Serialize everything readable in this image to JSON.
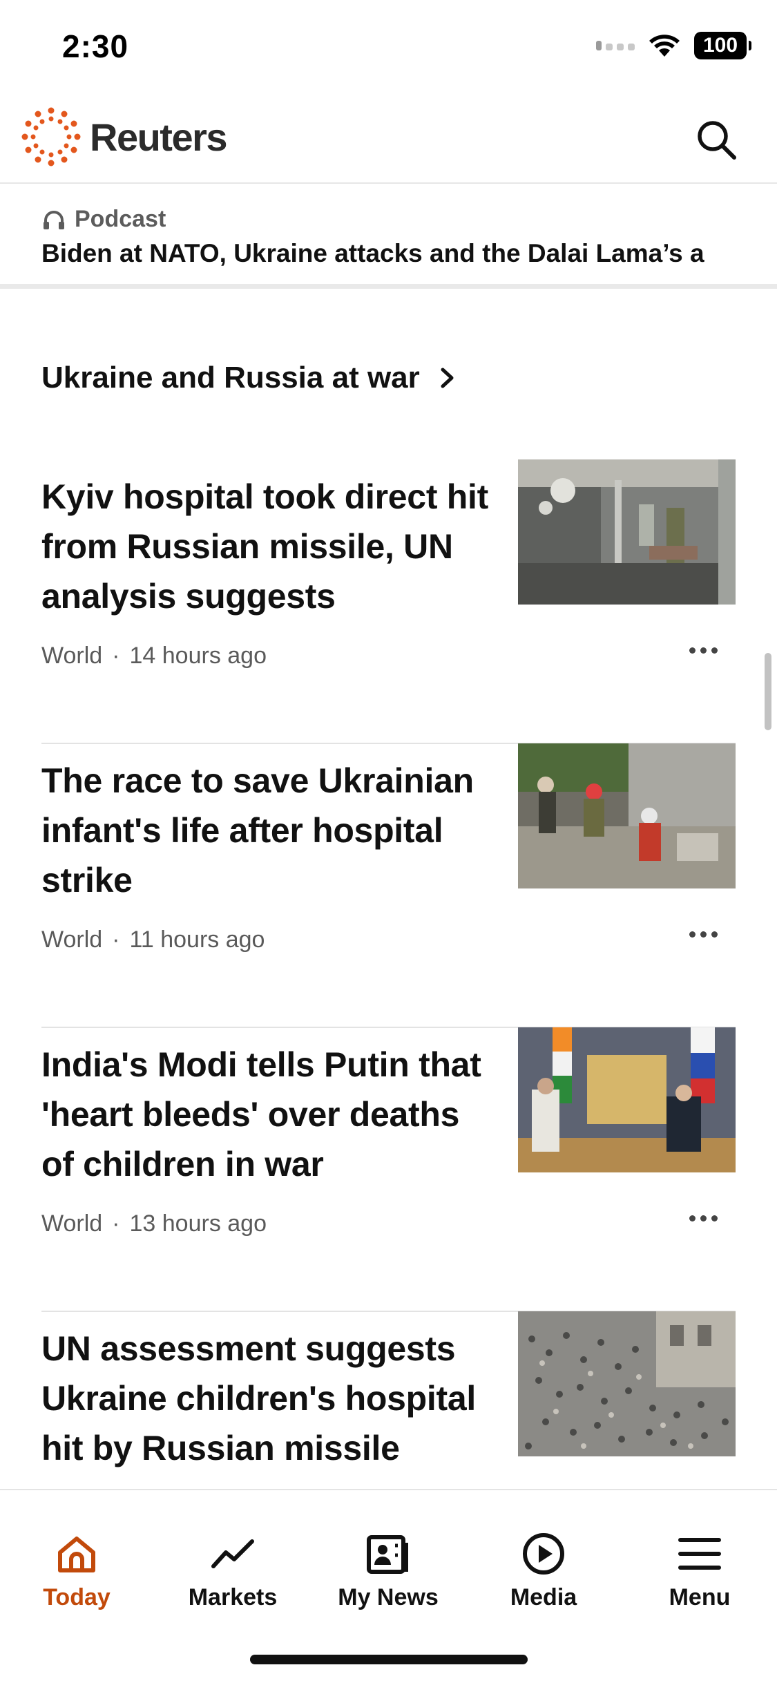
{
  "status_bar": {
    "time": "2:30",
    "battery": "100"
  },
  "header": {
    "brand": "Reuters"
  },
  "podcast": {
    "label": "Podcast",
    "title": "Biden at NATO, Ukraine attacks and the Dalai Lama’s a"
  },
  "section": {
    "title": "Ukraine and Russia at war"
  },
  "articles": [
    {
      "title": "Kyiv hospital took direct hit from Russian missile, UN analysis suggests",
      "category": "World",
      "separator": "·",
      "time": "14 hours ago"
    },
    {
      "title": "The race to save Ukrainian infant's life after hospital strike",
      "category": "World",
      "separator": "·",
      "time": "11 hours ago"
    },
    {
      "title": "India's Modi tells Putin that 'heart bleeds' over deaths of children in war",
      "category": "World",
      "separator": "·",
      "time": "13 hours ago"
    },
    {
      "title": "UN assessment suggests Ukraine children's hospital hit by Russian missile",
      "category": "",
      "separator": "",
      "time": ""
    }
  ],
  "tabs": [
    {
      "label": "Today",
      "icon": "home-icon",
      "active": true
    },
    {
      "label": "Markets",
      "icon": "trend-line-icon",
      "active": false
    },
    {
      "label": "My News",
      "icon": "news-icon",
      "active": false
    },
    {
      "label": "Media",
      "icon": "play-circle-icon",
      "active": false
    },
    {
      "label": "Menu",
      "icon": "menu-icon",
      "active": false
    }
  ],
  "colors": {
    "accent": "#c24a0b",
    "logo_orange": "#e3571d",
    "text": "#111111",
    "meta": "#5a5a5a"
  }
}
